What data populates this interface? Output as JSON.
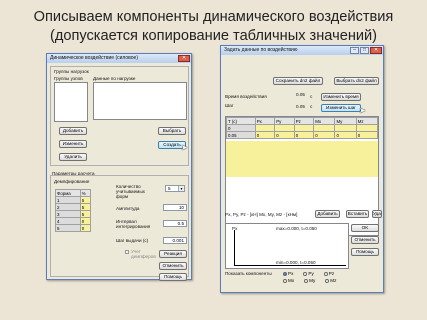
{
  "slide": {
    "title_line1": "Описываем компоненты динамического воздействия",
    "title_line2": "(допускается копирование табличных значений)"
  },
  "left_window": {
    "title": "Динамическое воздействие (силовое)",
    "groups_label": "Группы нагрузок",
    "group_nodes_label": "Группы узлов",
    "data_label": "Данные по нагрузке",
    "btn_add": "Добавить",
    "btn_edit": "Изменить",
    "btn_delete": "Удалить",
    "btn_select": "Выбрать",
    "btn_create": "Создать",
    "params_label": "Параметры расчета",
    "demping_label": "Демпфирование",
    "forms_headers": [
      "Форма",
      "%"
    ],
    "forms_rows": [
      [
        "1",
        "5"
      ],
      [
        "2",
        "5"
      ],
      [
        "3",
        "5"
      ],
      [
        "4",
        "0"
      ],
      [
        "5",
        "0"
      ]
    ],
    "count_label": "Количество учитываемых форм",
    "count_value": "5",
    "amplitude_label": "Амплитуда",
    "amplitude_value": "10",
    "interval_label": "Интервал интегрирования",
    "interval_value": "0.5",
    "step_label": "Шаг выдачи (с)",
    "step_value": "0.001",
    "dampers_label": "Учет демпферов",
    "btn_reaction": "Реакция",
    "btn_cancel": "Отменить",
    "btn_help": "Помощь"
  },
  "right_window": {
    "title": "Задать данные по воздействию",
    "btn_save_file": "Сохранить dn2 файл",
    "btn_choose_file": "Выбрать dn2 файл",
    "time_label": "Время воздействия",
    "time_value": "0.05",
    "time_unit": "с",
    "step_label": "Шаг",
    "step_value": "0.05",
    "step_unit": "с",
    "btn_change_time": "Изменить время",
    "btn_change_step": "Изменить шаг",
    "table_headers": [
      "T (с)",
      "Px",
      "Py",
      "Pz",
      "Mx",
      "My",
      "Mz"
    ],
    "table_rows": [
      [
        "0",
        "",
        "",
        "",
        "",
        "",
        ""
      ],
      [
        "0.05",
        "0",
        "0",
        "0",
        "0",
        "0",
        "0"
      ]
    ],
    "units_label": "Px, Py, Pz - [кН]   Mx, My, Mz - [кНм]",
    "btn_add": "Добавить",
    "btn_insert": "Вставить",
    "btn_delete": "Удалить",
    "chart_axis_label": "Px",
    "chart_max": "max=0.000, t=0.050",
    "chart_min": "min=0.000, t=0.050",
    "btn_ok": "OK",
    "btn_cancel": "Отменить",
    "btn_help": "Помощь",
    "show_components_label": "Показать компоненты",
    "radios": [
      "Px",
      "Py",
      "Pz",
      "Mx",
      "My",
      "Mz"
    ],
    "radio_selected": "Px"
  },
  "colors": {
    "table_highlight": "#f6f19a",
    "window_border": "#5a7fb8"
  }
}
